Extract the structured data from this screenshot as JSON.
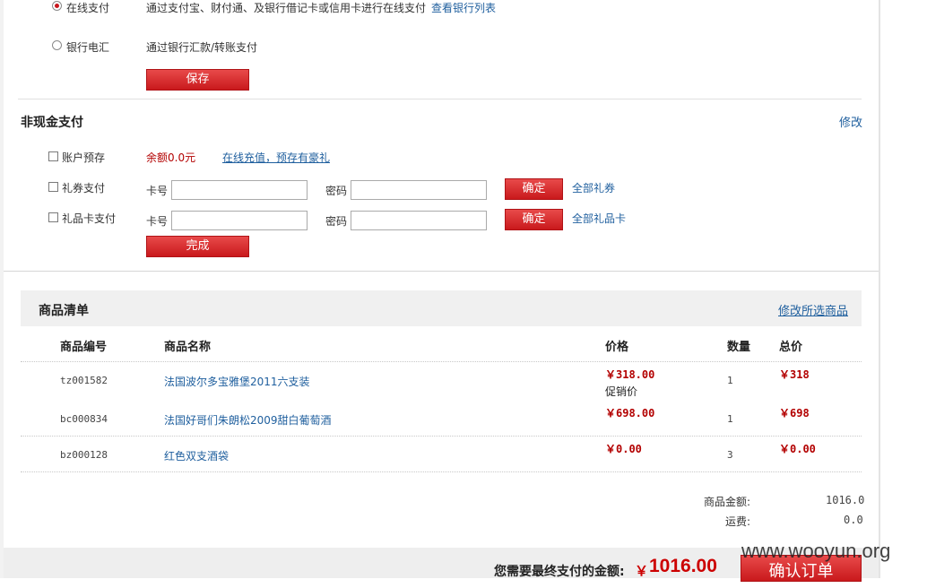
{
  "payment": {
    "online": {
      "label": "在线支付",
      "desc": "通过支付宝、财付通、及银行借记卡或信用卡进行在线支付",
      "bank_list_link": "查看银行列表"
    },
    "bank_transfer": {
      "label": "银行电汇",
      "desc": "通过银行汇款/转账支付"
    },
    "save_label": "保存"
  },
  "noncash": {
    "title": "非现金支付",
    "edit_link": "修改",
    "account": {
      "label": "账户预存",
      "balance": "余额0.0元",
      "recharge_link": "在线充值，预存有豪礼"
    },
    "coupon": {
      "label": "礼券支付",
      "card_label": "卡号",
      "pwd_label": "密码",
      "confirm": "确定",
      "all_link": "全部礼券"
    },
    "giftcard": {
      "label": "礼品卡支付",
      "card_label": "卡号",
      "pwd_label": "密码",
      "confirm": "确定",
      "all_link": "全部礼品卡"
    },
    "done_label": "完成"
  },
  "goods": {
    "title": "商品清单",
    "edit_link": "修改所选商品",
    "headers": {
      "id": "商品编号",
      "name": "商品名称",
      "price": "价格",
      "qty": "数量",
      "total": "总价"
    },
    "rows": [
      {
        "id": "tz001582",
        "name": "法国波尔多宝雅堡2011六支装",
        "price": "￥318.00",
        "note": "促销价",
        "qty": "1",
        "total": "￥318"
      },
      {
        "id": "bc000834",
        "name": "法国好哥们朱朗松2009甜白葡萄酒",
        "price": "￥698.00",
        "qty": "1",
        "total": "￥698"
      },
      {
        "id": "bz000128",
        "name": "红色双支酒袋",
        "price": "￥0.00",
        "qty": "3",
        "total": "￥0.00"
      }
    ]
  },
  "summary": {
    "goods_amount_label": "商品金额:",
    "goods_amount": "1016.0",
    "shipping_label": "运费:",
    "shipping": "0.0",
    "final_label": "您需要最终支付的金额:",
    "final_currency": "￥",
    "final_amount": "1016.00",
    "confirm_label": "确认订单"
  },
  "watermark": "www.wooyun.org"
}
